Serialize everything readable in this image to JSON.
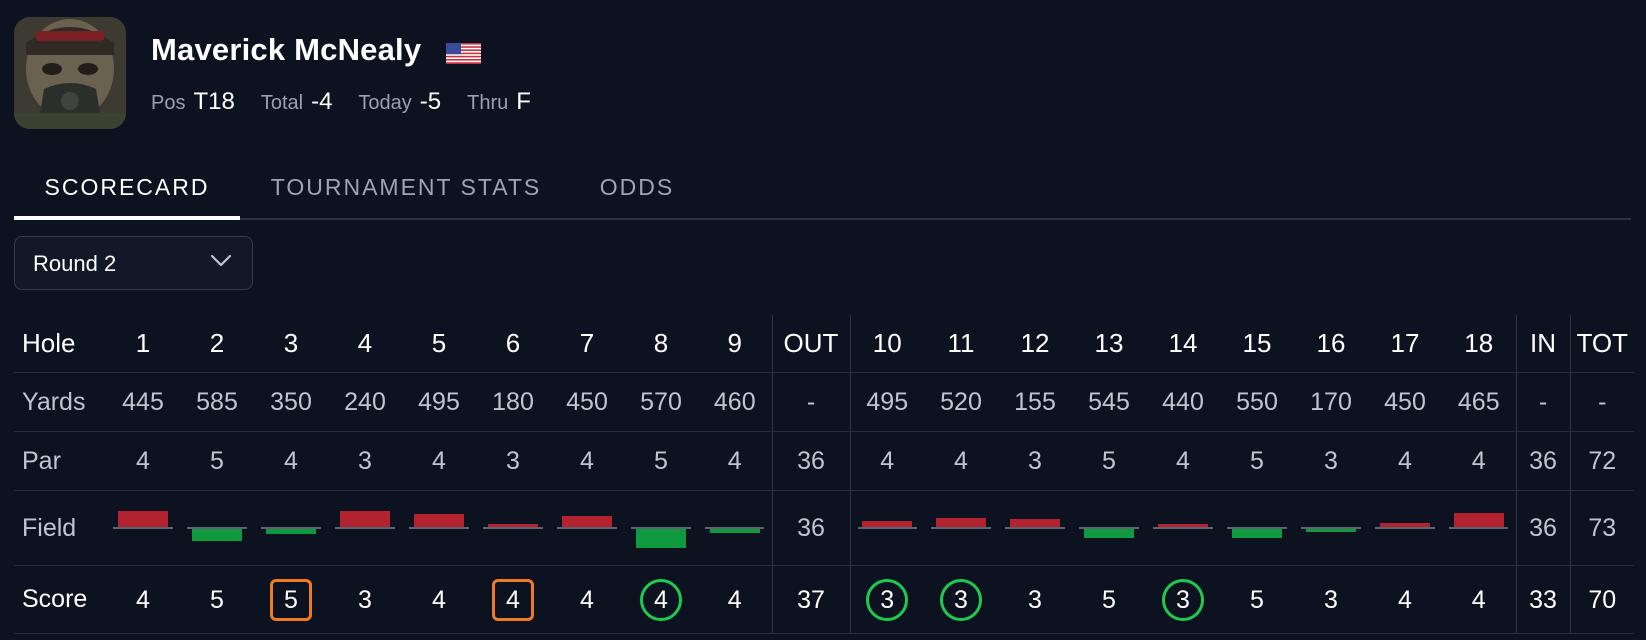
{
  "player": {
    "name": "Maverick McNealy",
    "stats": [
      {
        "label": "Pos",
        "value": "T18"
      },
      {
        "label": "Total",
        "value": "-4"
      },
      {
        "label": "Today",
        "value": "-5"
      },
      {
        "label": "Thru",
        "value": "F"
      }
    ]
  },
  "tabs": [
    {
      "label": "SCORECARD",
      "active": true
    },
    {
      "label": "TOURNAMENT STATS",
      "active": false
    },
    {
      "label": "ODDS",
      "active": false
    }
  ],
  "round_select": {
    "selected": "Round 2"
  },
  "colors": {
    "over": "#b3232f",
    "under": "#0f9a40",
    "bogey": "#f07a21",
    "birdie": "#1ec94f"
  },
  "scorecard": {
    "row_labels": {
      "hole": "Hole",
      "yards": "Yards",
      "par": "Par",
      "field": "Field",
      "score": "Score"
    },
    "holes": [
      "1",
      "2",
      "3",
      "4",
      "5",
      "6",
      "7",
      "8",
      "9",
      "OUT",
      "10",
      "11",
      "12",
      "13",
      "14",
      "15",
      "16",
      "17",
      "18",
      "IN",
      "TOT"
    ],
    "yards": [
      "445",
      "585",
      "350",
      "240",
      "495",
      "180",
      "450",
      "570",
      "460",
      "-",
      "495",
      "520",
      "155",
      "545",
      "440",
      "550",
      "170",
      "450",
      "465",
      "-",
      "-"
    ],
    "par": [
      "4",
      "5",
      "4",
      "3",
      "4",
      "3",
      "4",
      "5",
      "4",
      "36",
      "4",
      "4",
      "3",
      "5",
      "4",
      "5",
      "3",
      "4",
      "4",
      "36",
      "72"
    ],
    "field_relative_to_par": [
      0.18,
      -0.14,
      -0.06,
      0.18,
      0.15,
      0.03,
      0.12,
      -0.22,
      -0.05,
      null,
      0.07,
      0.1,
      0.09,
      -0.1,
      0.03,
      -0.11,
      -0.04,
      0.05,
      0.16,
      null,
      null
    ],
    "field_totals": {
      "OUT": "36",
      "IN": "36",
      "TOT": "73"
    },
    "score": [
      "4",
      "5",
      "5",
      "3",
      "4",
      "4",
      "4",
      "4",
      "4",
      "37",
      "3",
      "3",
      "3",
      "5",
      "3",
      "5",
      "3",
      "4",
      "4",
      "33",
      "70"
    ],
    "score_type": [
      "",
      "",
      "bogey",
      "",
      "",
      "bogey",
      "",
      "birdie",
      "",
      "",
      "birdie",
      "birdie",
      "",
      "",
      "birdie",
      "",
      "",
      "",
      "",
      "",
      ""
    ]
  }
}
